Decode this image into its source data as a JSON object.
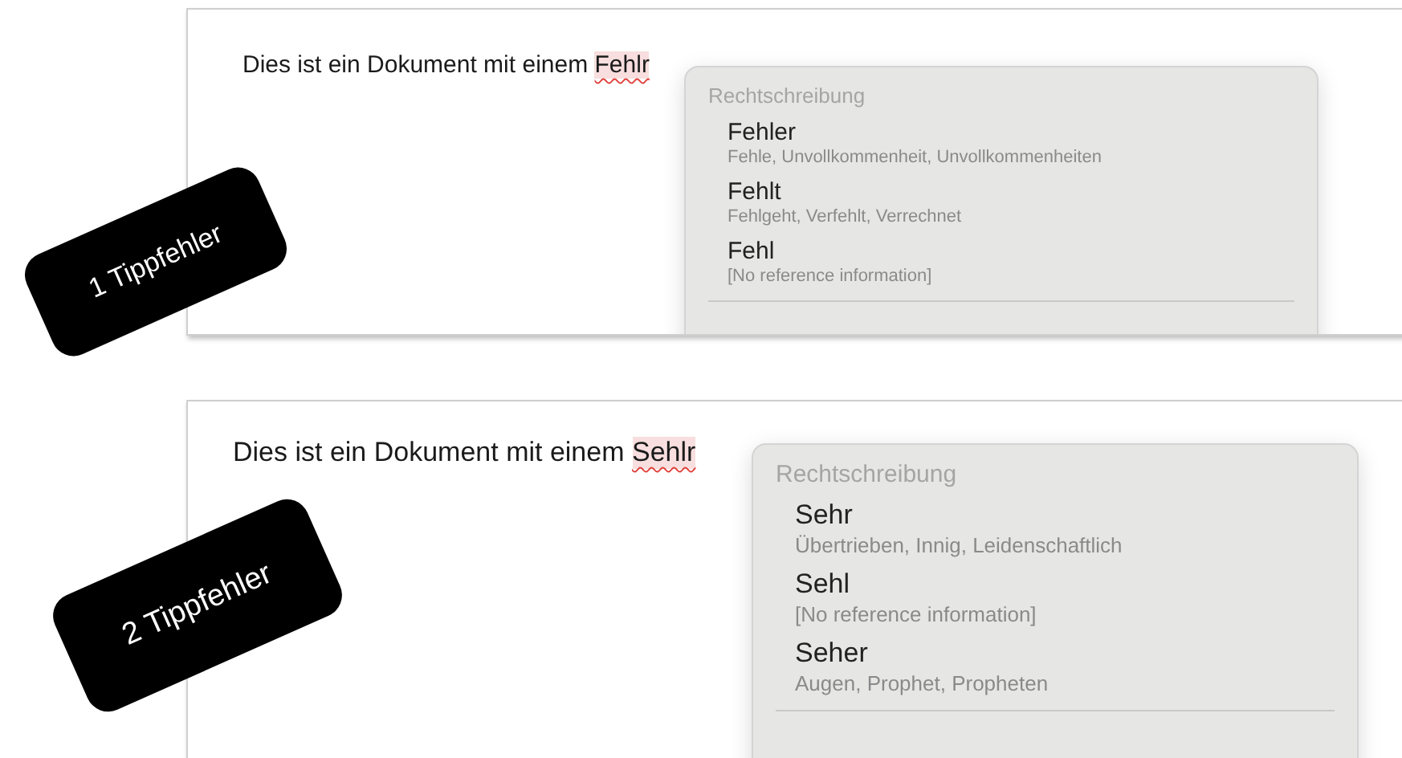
{
  "examples": [
    {
      "badge": "1 Tippfehler",
      "sentence": "Dies ist ein Dokument mit einem",
      "misspelled": "Fehlr",
      "menu": {
        "heading": "Rechtschreibung",
        "suggestions": [
          {
            "word": "Fehler",
            "detail": "Fehle, Unvollkommenheit, Unvollkommenheiten"
          },
          {
            "word": "Fehlt",
            "detail": "Fehlgeht, Verfehlt, Verrechnet"
          },
          {
            "word": "Fehl",
            "detail": "[No reference information]"
          }
        ]
      }
    },
    {
      "badge": "2 Tippfehler",
      "sentence": "Dies ist ein Dokument mit einem",
      "misspelled": "Sehlr",
      "menu": {
        "heading": "Rechtschreibung",
        "suggestions": [
          {
            "word": "Sehr",
            "detail": "Übertrieben, Innig, Leidenschaftlich"
          },
          {
            "word": "Sehl",
            "detail": "[No reference information]"
          },
          {
            "word": "Seher",
            "detail": "Augen, Prophet, Propheten"
          }
        ]
      }
    }
  ]
}
